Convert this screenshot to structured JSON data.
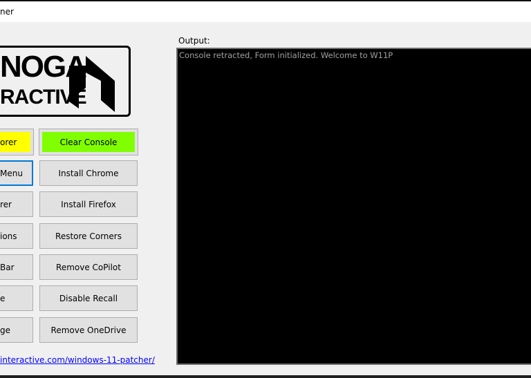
{
  "window": {
    "title": "ner"
  },
  "logo": {
    "line1": "NOGA",
    "line2": "RACTIVE"
  },
  "buttons_left": [
    "orer",
    "Menu",
    "rer",
    "ions",
    "Bar",
    "e",
    "ge"
  ],
  "buttons_right": [
    "Clear Console",
    "Install Chrome",
    "Install Firefox",
    "Restore Corners",
    "Remove CoPilot",
    "Disable Recall",
    "Remove OneDrive"
  ],
  "link": "interactive.com/windows-11-patcher/",
  "output": {
    "label": "Output:",
    "text": "Console retracted, Form initialized. Welcome to W11P"
  },
  "colors": {
    "highlight_yellow": "#ffff00",
    "clear_console_green": "#80ff00",
    "console_bg": "#000000",
    "focus": "#0078d7"
  }
}
